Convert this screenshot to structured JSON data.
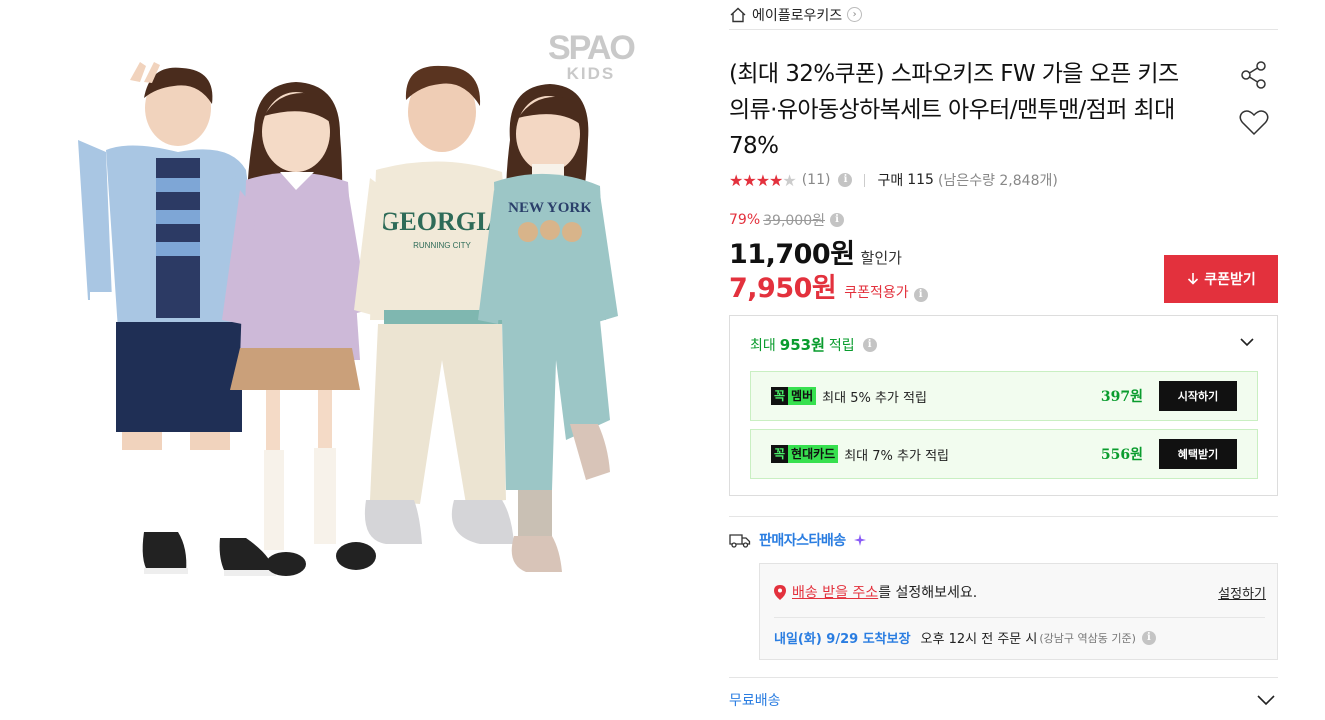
{
  "image": {
    "brand_logo_line1": "SPAO",
    "brand_logo_line2": "KIDS"
  },
  "store": {
    "name": "에이플로우키즈",
    "icon": "home-icon",
    "chevron": "›"
  },
  "product": {
    "title": "(최대 32%쿠폰) 스파오키즈 FW 가을 오픈 키즈의류·유아동상하복세트 아우터/맨투맨/점퍼 최대 78%",
    "share_icon": "share-icon",
    "wish_icon": "heart-icon"
  },
  "rating": {
    "stars_on": "★★★★",
    "stars_off": "★",
    "review_count": "(11)",
    "buy_label": "구매",
    "buy_count": "115",
    "remaining": "(남은수량 2,848개)"
  },
  "price": {
    "discount_rate": "79%",
    "original_price": "39,000원",
    "sale_price": "11,700원",
    "sale_label": "할인가",
    "coupon_price": "7,950원",
    "coupon_label": "쿠폰적용가",
    "coupon_button": "쿠폰받기",
    "info_glyph": "i"
  },
  "rewards": {
    "prefix": "최대",
    "amount": "953원",
    "suffix": "적립",
    "items": [
      {
        "badge_k": "꼭",
        "badge_name": "멤버",
        "text": "최대 5% 추가 적립",
        "amount": "397원",
        "button": "시작하기"
      },
      {
        "badge_k": "꼭",
        "badge_name": "현대카드",
        "text": "최대 7% 추가 적립",
        "amount": "556원",
        "button": "혜택받기"
      }
    ]
  },
  "delivery": {
    "star_label": "판매자스타배송",
    "address_link": "배송 받을 주소",
    "address_text": "를 설정해보세요.",
    "set_link": "설정하기",
    "arrival_date": "내일(화) 9/29 도착보장",
    "arrival_condition": "오후 12시 전 주문 시",
    "arrival_area": "(강남구 역삼동 기준)",
    "free_shipping": "무료배송"
  },
  "colors": {
    "accent_red": "#e3313d",
    "reward_green": "#0a9c2e",
    "link_blue": "#2a7de1"
  }
}
